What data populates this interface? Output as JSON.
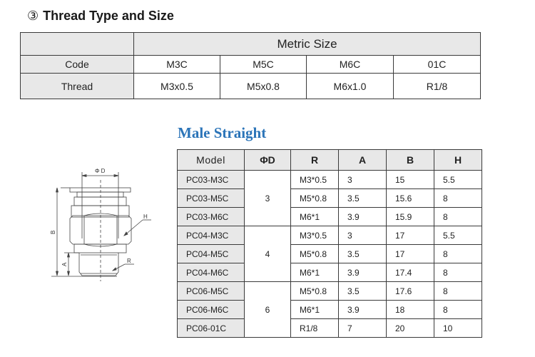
{
  "section": {
    "number": "③",
    "title": "Thread Type and Size"
  },
  "thread_table": {
    "group_header": "Metric Size",
    "row_labels": [
      "Code",
      "Thread"
    ],
    "codes": [
      "M3C",
      "M5C",
      "M6C",
      "01C"
    ],
    "threads": [
      "M3x0.5",
      "M5x0.8",
      "M6x1.0",
      "R1/8"
    ]
  },
  "product": {
    "title": "Male Straight"
  },
  "drawing": {
    "labels": {
      "phi_d": "Φ D",
      "b": "B",
      "a": "A",
      "h": "H",
      "r": "R"
    }
  },
  "model_table": {
    "headers": [
      "Model",
      "ΦD",
      "R",
      "A",
      "B",
      "H"
    ],
    "groups": [
      {
        "phi_d": "3",
        "rows": [
          {
            "model": "PC03-M3C",
            "r": "M3*0.5",
            "a": "3",
            "b": "15",
            "h": "5.5"
          },
          {
            "model": "PC03-M5C",
            "r": "M5*0.8",
            "a": "3.5",
            "b": "15.6",
            "h": "8"
          },
          {
            "model": "PC03-M6C",
            "r": "M6*1",
            "a": "3.9",
            "b": "15.9",
            "h": "8"
          }
        ]
      },
      {
        "phi_d": "4",
        "rows": [
          {
            "model": "PC04-M3C",
            "r": "M3*0.5",
            "a": "3",
            "b": "17",
            "h": "5.5"
          },
          {
            "model": "PC04-M5C",
            "r": "M5*0.8",
            "a": "3.5",
            "b": "17",
            "h": "8"
          },
          {
            "model": "PC04-M6C",
            "r": "M6*1",
            "a": "3.9",
            "b": "17.4",
            "h": "8"
          }
        ]
      },
      {
        "phi_d": "6",
        "rows": [
          {
            "model": "PC06-M5C",
            "r": "M5*0.8",
            "a": "3.5",
            "b": "17.6",
            "h": "8"
          },
          {
            "model": "PC06-M6C",
            "r": "M6*1",
            "a": "3.9",
            "b": "18",
            "h": "8"
          },
          {
            "model": "PC06-01C",
            "r": "R1/8",
            "a": "7",
            "b": "20",
            "h": "10"
          }
        ]
      }
    ]
  }
}
